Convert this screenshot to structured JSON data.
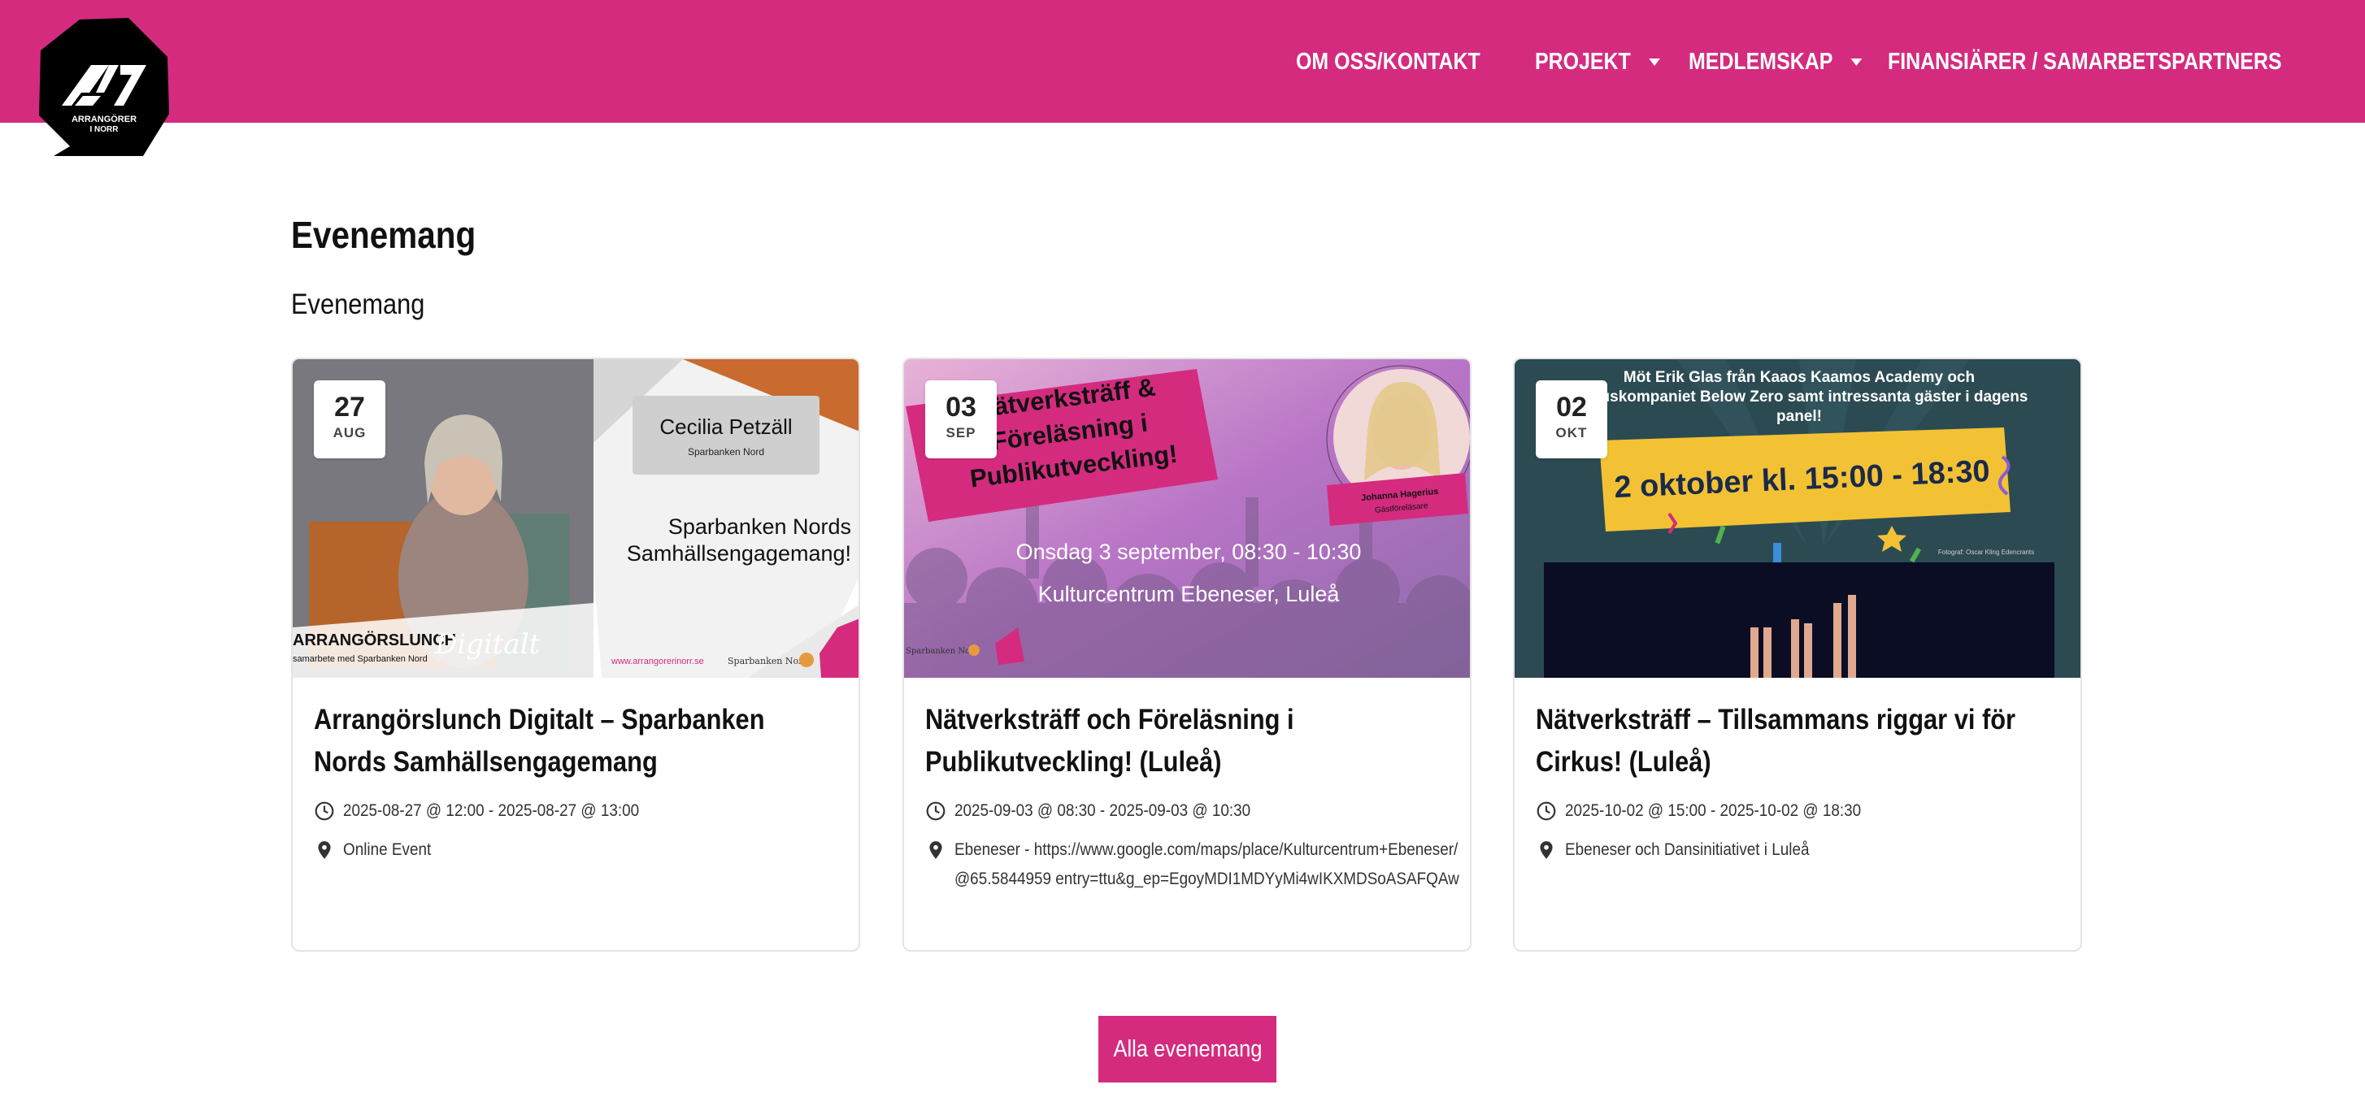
{
  "header": {
    "logo_text_line1": "ARRANGÖRER",
    "logo_text_line2": "I NORR",
    "nav": [
      {
        "label": "OM OSS/KONTAKT",
        "has_dropdown": false
      },
      {
        "label": "PROJEKT",
        "has_dropdown": true
      },
      {
        "label": "MEDLEMSKAP",
        "has_dropdown": true
      },
      {
        "label": "FINANSIÄRER / SAMARBETSPARTNERS",
        "has_dropdown": false
      }
    ]
  },
  "main": {
    "title": "Evenemang",
    "subtitle": "Evenemang"
  },
  "events": [
    {
      "day": "27",
      "month": "AUG",
      "title": "Arrangörslunch Digitalt – Sparbanken Nords Samhällsengagemang",
      "time": "2025-08-27 @ 12:00 - 2025-08-27 @ 13:00",
      "location": "Online Event",
      "image": {
        "name_box": "Cecilia Petzäll",
        "name_box_sub": "Sparbanken Nord",
        "headline_1": "Sparbanken Nords",
        "headline_2": "Samhällsengagemang!",
        "bottom_title": "ARRANGÖRSLUNCH",
        "bottom_sub": "samarbete med Sparbanken Nord",
        "script_word": "Digitalt",
        "url": "www.arrangorerinorr.se",
        "partner": "Sparbanken Nord"
      }
    },
    {
      "day": "03",
      "month": "SEP",
      "title": "Nätverksträff och Föreläsning i Publikutveckling! (Luleå)",
      "time": "2025-09-03 @ 08:30 - 2025-09-03 @ 10:30",
      "location": "Ebeneser - https://www.google.com/maps/place/Kulturcentrum+Ebeneser/@65.5844959 entry=ttu&g_ep=EgoyMDI1MDYyMi4wIKXMDSoASAFQAw",
      "image": {
        "banner_1": "Nätverksträff &",
        "banner_2": "Föreläsning i",
        "banner_3": "Publikutveckling!",
        "when": "Onsdag 3 september, 08:30 - 10:30",
        "where": "Kulturcentrum Ebeneser, Luleå",
        "speaker_name": "Johanna Hagerius",
        "speaker_role": "Gästföreläsare",
        "partner": "Sparbanken Nord"
      }
    },
    {
      "day": "02",
      "month": "OKT",
      "title": "Nätverksträff – Tillsammans riggar vi för Cirkus! (Luleå)",
      "time": "2025-10-02 @ 15:00 - 2025-10-02 @ 18:30",
      "location": "Ebeneser och Dansinitiativet i Luleå",
      "image": {
        "top_1": "Möt Erik Glas från Kaaos Kaamos Academy och",
        "top_2": "Cirkuskompaniet Below Zero samt intressanta gäster i dagens",
        "top_3": "panel!",
        "date_banner": "2 oktober kl. 15:00 - 18:30",
        "photo_credit": "Fotograf: Oscar Kling Edencrants"
      }
    }
  ],
  "actions": {
    "all_events": "Alla evenemang"
  },
  "colors": {
    "brand": "#d42b7f",
    "text": "#111111"
  }
}
